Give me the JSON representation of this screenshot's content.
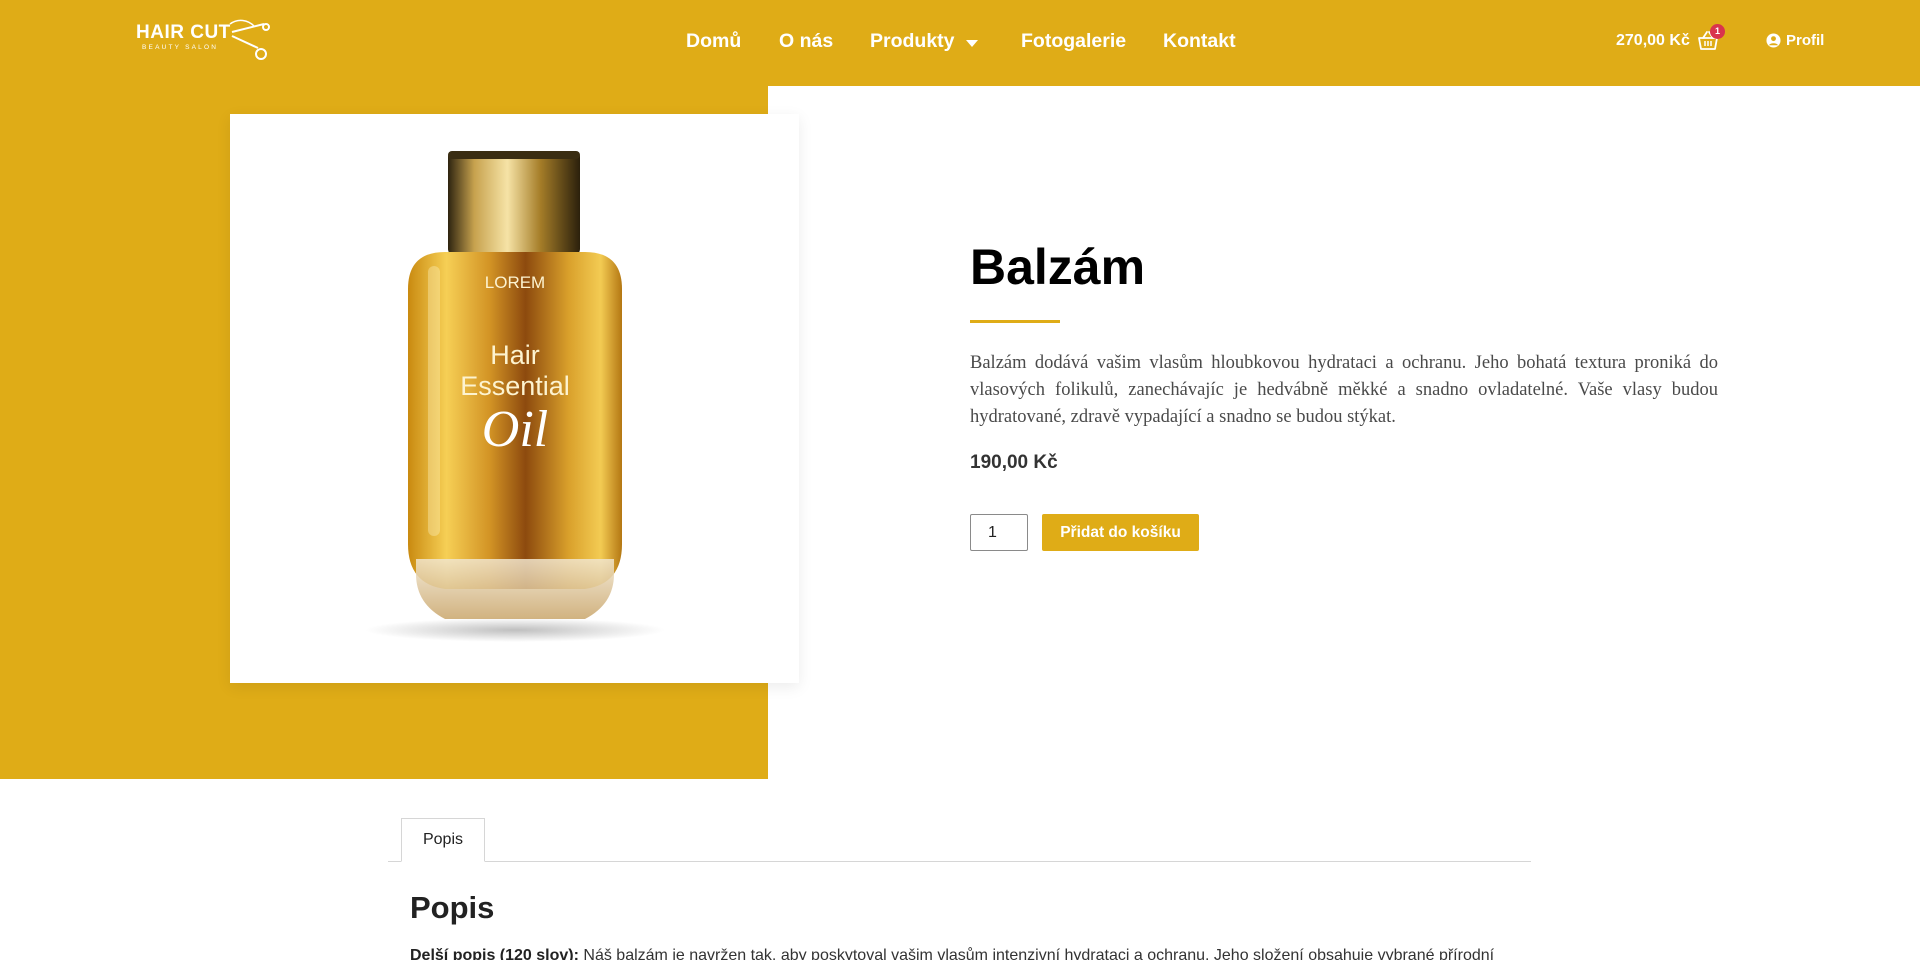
{
  "brand": {
    "logo_main": "HAIR CUT",
    "logo_sub": "BEAUTY SALON"
  },
  "nav": {
    "items": [
      {
        "label": "Domů"
      },
      {
        "label": "O nás"
      },
      {
        "label": "Produkty",
        "has_dropdown": true
      },
      {
        "label": "Fotogalerie"
      },
      {
        "label": "Kontakt"
      }
    ]
  },
  "cart": {
    "total": "270,00 Kč",
    "count": "1",
    "icon": "basket-icon"
  },
  "profile": {
    "label": "Profil",
    "icon": "user-circle-icon"
  },
  "product": {
    "name": "Balzám",
    "description": "Balzám dodává vašim vlasům hloubkovou hydrataci a ochranu. Jeho bohatá textura proniká do vlasových folikulů, zanechávajíc je hedvábně měkké a snadno ovladatelné. Vaše vlasy budou hydratované, zdravě vypadající a snadno se budou stýkat.",
    "price": "190,00 Kč",
    "quantity": "1",
    "add_to_cart_label": "Přidat do košíku",
    "image": {
      "label_top": "LOREM",
      "label_line1": "Hair",
      "label_line2": "Essential",
      "label_line3": "Oil"
    }
  },
  "tabs": [
    {
      "label": "Popis",
      "active": true
    }
  ],
  "details": {
    "heading": "Popis",
    "long_desc_label": "Delší popis (120 slov):",
    "long_desc_text": "Náš balzám je navržen tak, aby poskytoval vašim vlasům intenzivní hydrataci a ochranu. Jeho složení obsahuje vybrané přírodní"
  },
  "colors": {
    "accent": "#DFAC17",
    "badge": "#d9344d"
  }
}
